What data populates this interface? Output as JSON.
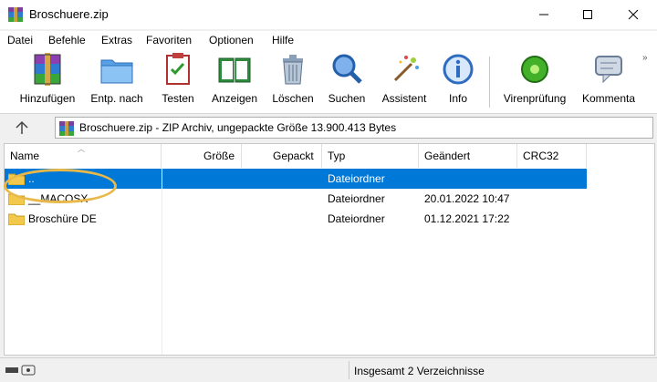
{
  "window": {
    "title": "Broschuere.zip"
  },
  "menu": [
    "Datei",
    "Befehle",
    "Extras",
    "Favoriten",
    "Optionen",
    "Hilfe"
  ],
  "toolbar": {
    "buttons": [
      {
        "label": "Hinzufügen",
        "icon": "archive-add-icon"
      },
      {
        "label": "Entp. nach",
        "icon": "extract-folder-icon"
      },
      {
        "label": "Testen",
        "icon": "test-checklist-icon"
      },
      {
        "label": "Anzeigen",
        "icon": "view-book-icon"
      },
      {
        "label": "Löschen",
        "icon": "trash-icon"
      },
      {
        "label": "Suchen",
        "icon": "search-icon"
      },
      {
        "label": "Assistent",
        "icon": "wizard-wand-icon"
      },
      {
        "label": "Info",
        "icon": "info-icon"
      },
      {
        "label": "Virenprüfung",
        "icon": "virus-scan-icon"
      },
      {
        "label": "Kommenta",
        "icon": "comment-icon"
      }
    ],
    "more": "»"
  },
  "address": {
    "text": "Broschuere.zip - ZIP Archiv, ungepackte Größe 13.900.413 Bytes"
  },
  "columns": [
    "Name",
    "Größe",
    "Gepackt",
    "Typ",
    "Geändert",
    "CRC32"
  ],
  "rows": [
    {
      "name": "..",
      "size": "",
      "packed": "",
      "type": "Dateiordner",
      "modified": "",
      "crc": "",
      "selected": true
    },
    {
      "name": "__MACOSX",
      "size": "",
      "packed": "",
      "type": "Dateiordner",
      "modified": "20.01.2022 10:47",
      "crc": "",
      "selected": false
    },
    {
      "name": "Broschüre DE",
      "size": "",
      "packed": "",
      "type": "Dateiordner",
      "modified": "01.12.2021 17:22",
      "crc": "",
      "selected": false
    }
  ],
  "status": {
    "text": "Insgesamt 2 Verzeichnisse"
  },
  "colors": {
    "selection": "#0078d7",
    "highlight_ring": "#e8b84a",
    "folder": "#f2c94c"
  }
}
